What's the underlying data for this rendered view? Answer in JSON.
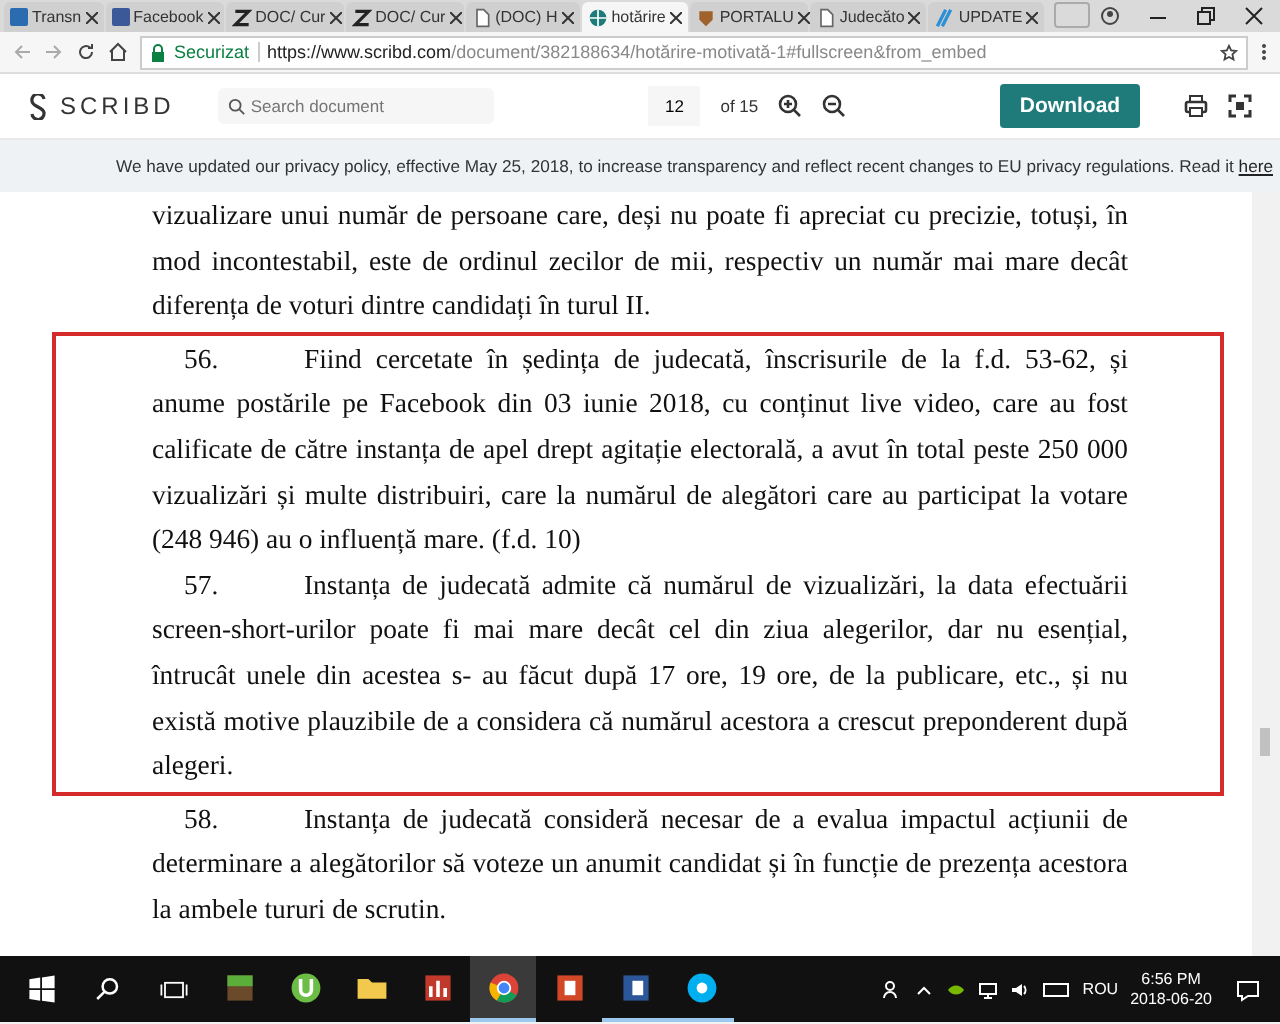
{
  "browser": {
    "tabs": [
      {
        "title": "Transn",
        "selected": false,
        "kind": "doc"
      },
      {
        "title": "Facebook",
        "selected": false,
        "kind": "social"
      },
      {
        "title": "DOC/ Cur",
        "selected": false,
        "kind": "zletter"
      },
      {
        "title": "DOC/ Cur",
        "selected": false,
        "kind": "zletter"
      },
      {
        "title": "(DOC) H",
        "selected": false,
        "kind": "page"
      },
      {
        "title": "hotărire",
        "selected": true,
        "kind": "globe"
      },
      {
        "title": "PORTALU",
        "selected": false,
        "kind": "crest"
      },
      {
        "title": "Judecăto",
        "selected": false,
        "kind": "page"
      },
      {
        "title": "UPDATE",
        "selected": false,
        "kind": "stripes"
      }
    ],
    "address": {
      "secure_label": "Securizat",
      "url_host": "https://www.scribd.com",
      "url_path": "/document/382188634/hotărire-motivată-1#fullscreen&from_embed"
    }
  },
  "scribd": {
    "logo": "SCRIBD",
    "search_placeholder": "Search document",
    "page": "12",
    "page_total": "of 15",
    "download": "Download"
  },
  "banner": {
    "text": "We have updated our privacy policy, effective May 25, 2018, to increase transparency and reflect recent changes to EU privacy regulations. Read it",
    "link": "here"
  },
  "document": {
    "paragraphs": [
      {
        "text": "vizualizare unui număr de persoane care, deși nu poate fi apreciat cu precizie, totuși, în mod incontestabil, este de ordinul zecilor de mii, respectiv un număr mai mare decât diferența de voturi dintre candidați în turul II.",
        "highlighted": false
      },
      {
        "number": "56.",
        "text": "Fiind cercetate în ședința de judecată, înscrisurile de la f.d. 53-62, și anume postările pe Facebook din 03 iunie 2018, cu conținut live video, care au fost calificate de către instanța de apel drept agitație electorală, a avut în total peste 250 000 vizualizări și multe distribuiri, care la numărul de alegători care au participat la votare (248 946) au o influență mare. (f.d. 10)",
        "highlighted": true
      },
      {
        "number": "57.",
        "text": "Instanța de judecată admite că numărul de vizualizări, la data efectuării screen-short-urilor poate fi mai mare decât cel din ziua alegerilor, dar nu  esențial, întrucât unele din acestea s- au făcut după 17 ore, 19 ore, de la publicare, etc., și nu există motive plauzibile de a considera că numărul acestora a crescut preponderent după alegeri.",
        "highlighted": true
      },
      {
        "number": "58.",
        "text": "Instanța de judecată consideră necesar de a evalua impactul acțiunii de determinare a alegătorilor să voteze un anumit candidat și în funcție de prezența acestora la ambele tururi de scrutin.",
        "highlighted": false
      }
    ]
  },
  "taskbar": {
    "apps": [
      {
        "kind": "game",
        "running": false,
        "selected": false
      },
      {
        "kind": "torrent",
        "running": false,
        "selected": false
      },
      {
        "kind": "folder",
        "running": false,
        "selected": false
      },
      {
        "kind": "chart",
        "running": false,
        "selected": false
      },
      {
        "kind": "browser",
        "running": true,
        "selected": true
      },
      {
        "kind": "slides",
        "running": false,
        "selected": false
      },
      {
        "kind": "word",
        "running": true,
        "selected": false
      },
      {
        "kind": "chat",
        "running": true,
        "selected": false
      }
    ],
    "language": "ROU",
    "time": "6:56 PM",
    "date": "2018-06-20"
  }
}
